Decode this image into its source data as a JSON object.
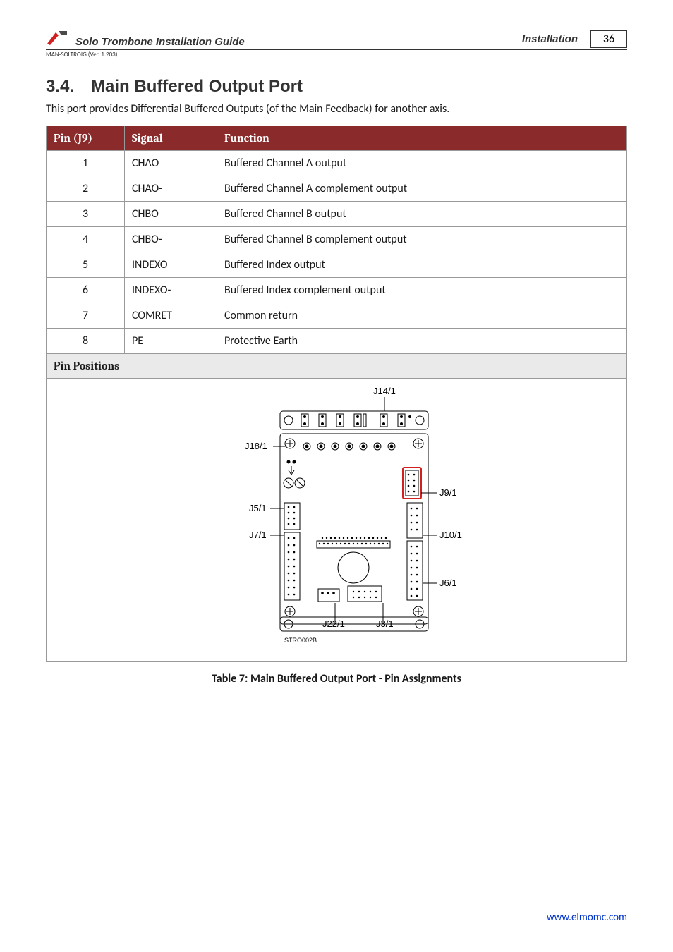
{
  "header": {
    "doc_title": "Solo Trombone Installation Guide",
    "section": "Installation",
    "page_number": "36",
    "version_line": "MAN-SOLTROIG (Ver. 1.203)"
  },
  "section_number": "3.4.",
  "section_title": "Main Buffered Output Port",
  "intro": "This port provides Differential Buffered Outputs (of the Main Feedback) for another axis.",
  "table": {
    "headers": {
      "pin": "Pin (J9)",
      "signal": "Signal",
      "function": "Function"
    },
    "rows": [
      {
        "pin": "1",
        "signal": "CHAO",
        "function": "Buffered Channel A output"
      },
      {
        "pin": "2",
        "signal": "CHAO-",
        "function": "Buffered Channel A complement output"
      },
      {
        "pin": "3",
        "signal": "CHBO",
        "function": "Buffered Channel B output"
      },
      {
        "pin": "4",
        "signal": "CHBO-",
        "function": "Buffered Channel B complement output"
      },
      {
        "pin": "5",
        "signal": "INDEXO",
        "function": "Buffered Index output"
      },
      {
        "pin": "6",
        "signal": "INDEXO-",
        "function": "Buffered Index complement output"
      },
      {
        "pin": "7",
        "signal": "COMRET",
        "function": "Common return"
      },
      {
        "pin": "8",
        "signal": "PE",
        "function": "Protective Earth"
      }
    ],
    "pin_positions_label": "Pin Positions"
  },
  "diagram": {
    "labels": {
      "j14": "J14/1",
      "j18": "J18/1",
      "j5": "J5/1",
      "j7": "J7/1",
      "j9": "J9/1",
      "j10": "J10/1",
      "j6": "J6/1",
      "j22": "J22/1",
      "j3": "J3/1",
      "code": "STRO002B"
    }
  },
  "caption": "Table 7: Main Buffered Output Port - Pin Assignments",
  "footer_link": "www.elmomc.com"
}
